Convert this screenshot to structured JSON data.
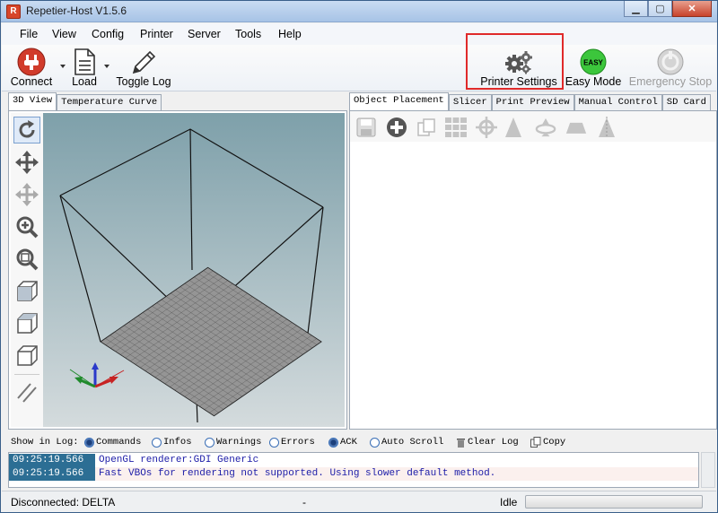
{
  "window": {
    "title": "Repetier-Host V1.5.6"
  },
  "menu": [
    "File",
    "View",
    "Config",
    "Printer",
    "Server",
    "Tools",
    "Help"
  ],
  "toolbar": {
    "connect": "Connect",
    "load": "Load",
    "toggle_log": "Toggle Log",
    "printer_settings": "Printer Settings",
    "easy_mode": "Easy Mode",
    "easy_badge": "EASY",
    "emergency_stop": "Emergency Stop"
  },
  "left_tabs": [
    "3D View",
    "Temperature Curve"
  ],
  "right_tabs": [
    "Object Placement",
    "Slicer",
    "Print Preview",
    "Manual Control",
    "SD Card"
  ],
  "log": {
    "show_in_log": "Show in Log:",
    "options": [
      {
        "label": "Commands",
        "checked": true
      },
      {
        "label": "Infos",
        "checked": false
      },
      {
        "label": "Warnings",
        "checked": false
      },
      {
        "label": "Errors",
        "checked": false
      },
      {
        "label": "ACK",
        "checked": true
      },
      {
        "label": "Auto Scroll",
        "checked": false
      }
    ],
    "clear_log": "Clear Log",
    "copy": "Copy",
    "entries": [
      {
        "time": "09:25:19.566",
        "message": "OpenGL renderer:GDI Generic"
      },
      {
        "time": "09:25:19.566",
        "message": "Fast VBOs for rendering not supported. Using slower default method."
      }
    ]
  },
  "status": {
    "connection": "Disconnected: DELTA",
    "separator": "-",
    "state": "Idle"
  },
  "colors": {
    "connect_red": "#d13b2b",
    "easy_green": "#3cc63c",
    "highlight_red": "#e02a2a",
    "log_time_bg": "#2c6e94",
    "log_msg": "#1c1ca8"
  }
}
